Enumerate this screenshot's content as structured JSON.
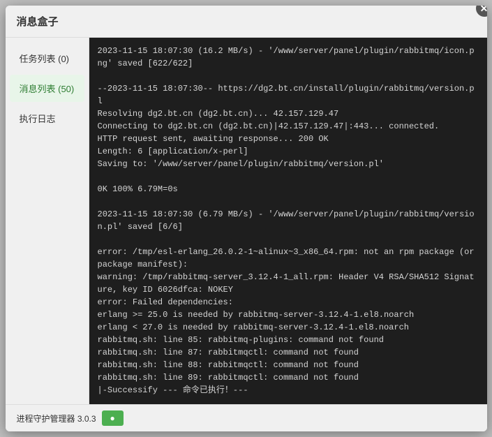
{
  "modal": {
    "title": "消息盒子",
    "close_icon": "✕"
  },
  "sidebar": {
    "items": [
      {
        "id": "task-list",
        "label": "任务列表 (0)",
        "active": false
      },
      {
        "id": "message-list",
        "label": "消息列表 (50)",
        "active": true
      },
      {
        "id": "exec-log",
        "label": "执行日志",
        "active": false
      }
    ]
  },
  "terminal": {
    "content": "2023-11-15 18:07:30 (16.2 MB/s) - '/www/server/panel/plugin/rabbitmq/icon.png' saved [622/622]\n\n--2023-11-15 18:07:30-- https://dg2.bt.cn/install/plugin/rabbitmq/version.pl\nResolving dg2.bt.cn (dg2.bt.cn)... 42.157.129.47\nConnecting to dg2.bt.cn (dg2.bt.cn)|42.157.129.47|:443... connected.\nHTTP request sent, awaiting response... 200 OK\nLength: 6 [application/x-perl]\nSaving to: '/www/server/panel/plugin/rabbitmq/version.pl'\n\n0K 100% 6.79M=0s\n\n2023-11-15 18:07:30 (6.79 MB/s) - '/www/server/panel/plugin/rabbitmq/version.pl' saved [6/6]\n\nerror: /tmp/esl-erlang_26.0.2-1~alinux~3_x86_64.rpm: not an rpm package (or package manifest):\nwarning: /tmp/rabbitmq-server_3.12.4-1_all.rpm: Header V4 RSA/SHA512 Signature, key ID 6026dfca: NOKEY\nerror: Failed dependencies:\nerlang >= 25.0 is needed by rabbitmq-server-3.12.4-1.el8.noarch\nerlang < 27.0 is needed by rabbitmq-server-3.12.4-1.el8.noarch\nrabbitmq.sh: line 85: rabbitmq-plugins: command not found\nrabbitmq.sh: line 87: rabbitmqctl: command not found\nrabbitmq.sh: line 88: rabbitmqctl: command not found\nrabbitmq.sh: line 89: rabbitmqctl: command not found\n|-Successify --- 命令已执行！---"
  },
  "footer": {
    "text": "进程守护管理器 3.0.3",
    "button_label": "●"
  }
}
